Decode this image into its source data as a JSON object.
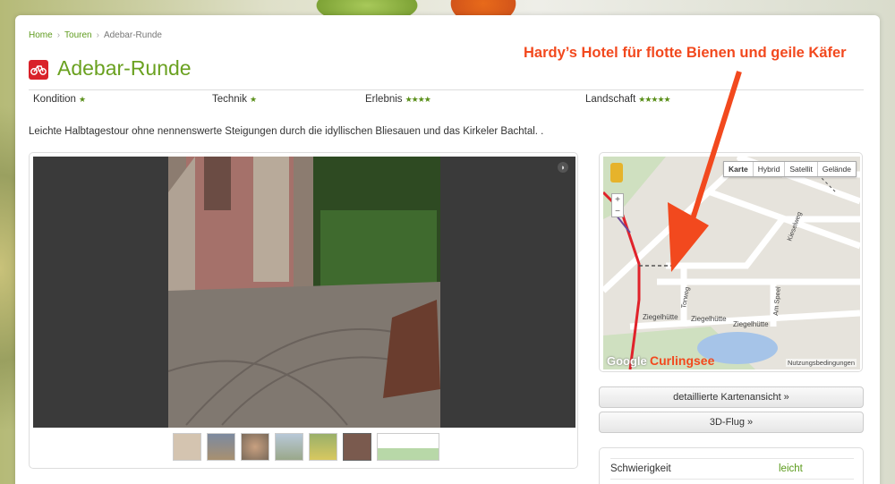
{
  "breadcrumb": {
    "home": "Home",
    "tours": "Touren",
    "current": "Adebar-Runde",
    "separator": "›"
  },
  "page": {
    "title": "Adebar-Runde",
    "title_icon": "bicycle-icon",
    "description": "Leichte Halbtagestour ohne nennenswerte Steigungen durch die idyllischen Bliesauen und das Kirkeler Bachtal. ."
  },
  "ratings": [
    {
      "label": "Kondition",
      "stars": "★"
    },
    {
      "label": "Technik",
      "stars": "★"
    },
    {
      "label": "Erlebnis",
      "stars": "★★★★"
    },
    {
      "label": "Landschaft",
      "stars": "★★★★★"
    }
  ],
  "map": {
    "types": [
      "Karte",
      "Hybrid",
      "Satellit",
      "Gelände"
    ],
    "active_type": "Karte",
    "zoom_in": "+",
    "zoom_out": "−",
    "terms": "Nutzungsbedingungen",
    "logo": "Google",
    "streets": {
      "kiesel": "Kieselweg",
      "torweg": "Torweg",
      "amspeel": "Am Speel",
      "ziegel1": "Ziegelhütte",
      "ziegel2": "Ziegelhütte",
      "ziegel3": "Ziegelhütte"
    }
  },
  "buttons": {
    "map_detail": "detaillierte Kartenansicht »",
    "flight3d": "3D-Flug »"
  },
  "info": {
    "difficulty_label": "Schwierigkeit",
    "difficulty_value": "leicht"
  },
  "annotations": {
    "headline": "Hardy’s Hotel für flotte Bienen und geile Käfer",
    "lake": "Curlingsee"
  },
  "colors": {
    "brand_green": "#6aa120",
    "annotation": "#f2491e",
    "route": "#e0222a"
  }
}
